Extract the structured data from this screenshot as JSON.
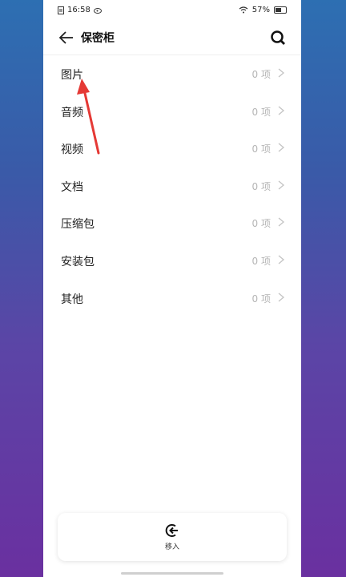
{
  "status_bar": {
    "time": "16:58",
    "battery": "57%"
  },
  "header": {
    "title": "保密柜"
  },
  "list": [
    {
      "label": "图片",
      "count": "0 项"
    },
    {
      "label": "音频",
      "count": "0 项"
    },
    {
      "label": "视频",
      "count": "0 项"
    },
    {
      "label": "文档",
      "count": "0 项"
    },
    {
      "label": "压缩包",
      "count": "0 项"
    },
    {
      "label": "安装包",
      "count": "0 项"
    },
    {
      "label": "其他",
      "count": "0 项"
    }
  ],
  "bottom_bar": {
    "move_in_label": "移入"
  },
  "colors": {
    "annotation_arrow": "#e53935",
    "muted_text": "#b5b5b5"
  }
}
